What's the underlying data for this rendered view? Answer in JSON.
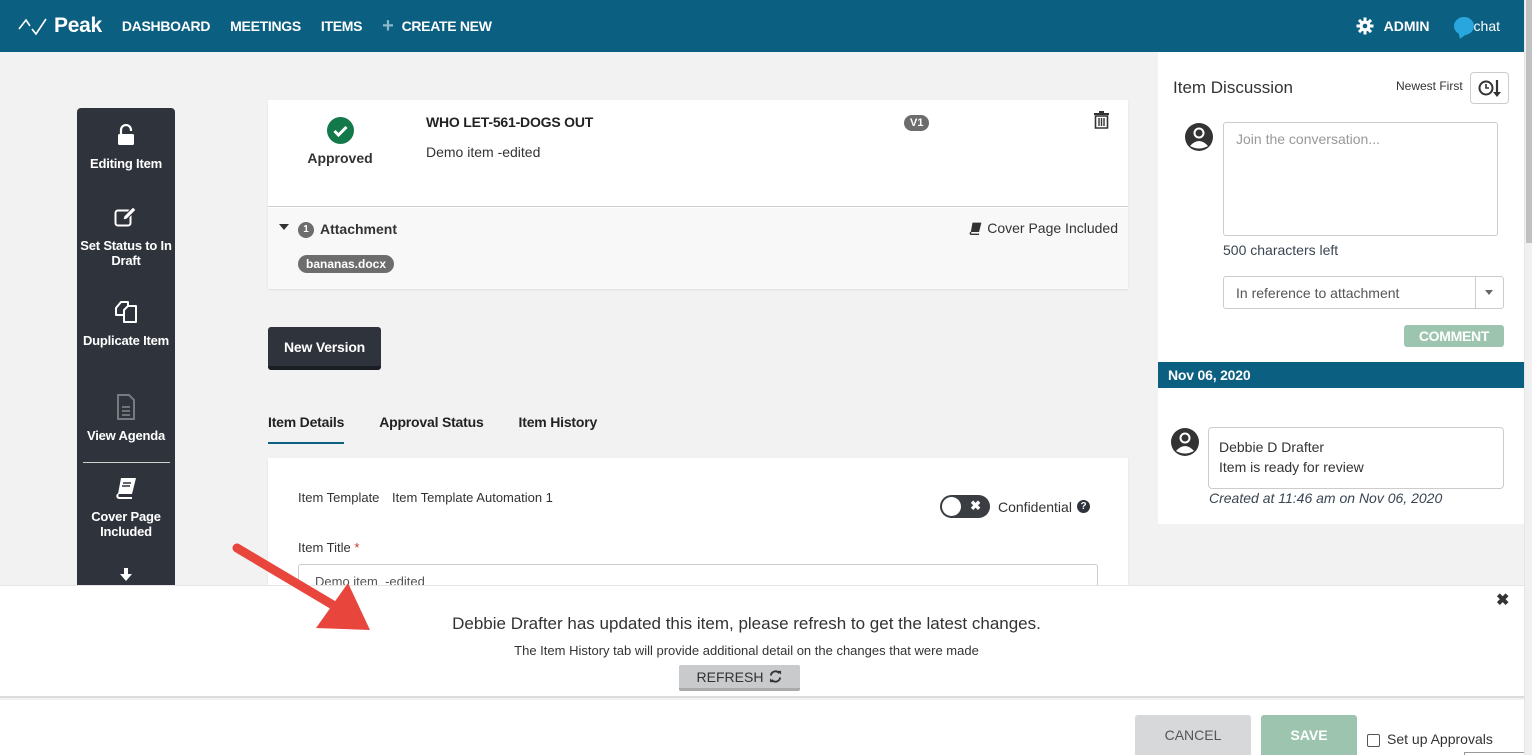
{
  "nav": {
    "brand": "Peak",
    "items": [
      "DASHBOARD",
      "MEETINGS",
      "ITEMS"
    ],
    "create_new": "CREATE NEW",
    "admin": "ADMIN",
    "chat": "chat"
  },
  "sidebar": {
    "actions": [
      {
        "label": "Editing Item",
        "icon": "unlock-icon",
        "enabled": true
      },
      {
        "label": "Set Status to In Draft",
        "icon": "edit-icon",
        "enabled": true
      },
      {
        "label": "Duplicate Item",
        "icon": "copy-icon",
        "enabled": true
      },
      {
        "label": "View Agenda",
        "icon": "document-icon",
        "enabled": false
      },
      {
        "label": "Cover Page Included",
        "icon": "book-icon",
        "enabled": true
      },
      {
        "label": "",
        "icon": "download-icon",
        "enabled": true
      }
    ]
  },
  "item": {
    "status": "Approved",
    "status_color": "#14794a",
    "title": "WHO LET-561-DOGS OUT",
    "description": "Demo item -edited",
    "version": "V1",
    "attachment_count": "1",
    "attachment_label": "Attachment",
    "attachments": [
      "bananas.docx"
    ],
    "cover_page": "Cover Page Included"
  },
  "main": {
    "new_version": "New Version",
    "tabs": [
      {
        "label": "Item Details",
        "active": true
      },
      {
        "label": "Approval Status",
        "active": false
      },
      {
        "label": "Item History",
        "active": false
      }
    ],
    "template_label": "Item Template",
    "template_value": "Item Template Automation 1",
    "confidential_label": "Confidential",
    "confidential_on": false,
    "title_label": "Item Title",
    "title_required": "*",
    "title_value": "Demo item  -edited"
  },
  "discussion": {
    "title": "Item Discussion",
    "sort_label": "Newest First",
    "placeholder": "Join the conversation...",
    "chars_left": "500 characters left",
    "reference_select": "In reference to attachment",
    "comment_button": "COMMENT",
    "date_header": "Nov 06, 2020",
    "comments": [
      {
        "author": "Debbie D Drafter",
        "body": "Item is ready for review",
        "meta": "Created at 11:46 am on Nov 06, 2020"
      }
    ]
  },
  "notification": {
    "message": "Debbie Drafter has updated this item, please refresh to get the latest changes.",
    "sub": "The Item History tab will provide additional detail on the changes that were made",
    "refresh": "REFRESH"
  },
  "footer": {
    "cancel": "CANCEL",
    "save": "SAVE",
    "approvals_label": "Set up Approvals",
    "approvals_checked": false
  },
  "colors": {
    "brand": "#0b5f80",
    "sidebar": "#2f333b",
    "save_green": "#9dc4ae",
    "annotation_arrow": "#e8453c"
  }
}
